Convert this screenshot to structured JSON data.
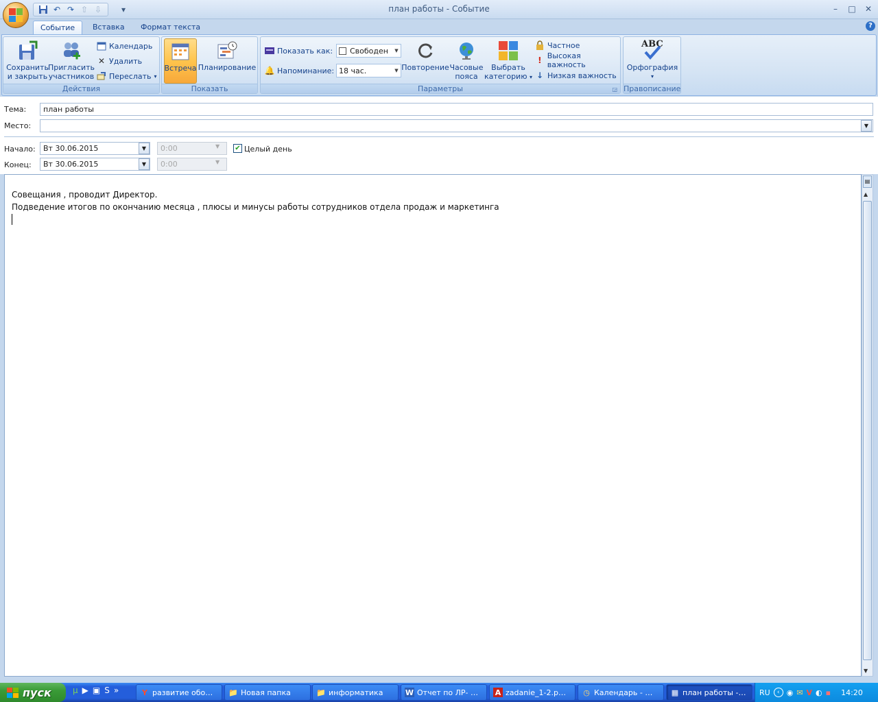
{
  "window": {
    "title": "план работы - Событие",
    "min": "–",
    "max": "□",
    "close": "✕"
  },
  "qat": {
    "save": "💾",
    "undo": "↶",
    "redo": "↷",
    "up": "⇧",
    "down": "⇩",
    "more": "▾"
  },
  "tabs": [
    "Событие",
    "Вставка",
    "Формат текста"
  ],
  "help": "?",
  "ribbon": {
    "actions": {
      "label": "Действия",
      "save": "Сохранить\nи закрыть",
      "invite": "Пригласить\nучастников",
      "calendar": "Календарь",
      "delete": "Удалить",
      "forward": "Переслать",
      "forward_arrow": "▾"
    },
    "show": {
      "label": "Показать",
      "meeting": "Встреча",
      "planning": "Планирование"
    },
    "params": {
      "label": "Параметры",
      "show_as_label": "Показать как:",
      "show_as_value": "Свободен",
      "reminder_label": "Напоминание:",
      "reminder_value": "18 час.",
      "recurrence": "Повторение",
      "timezones": "Часовые\nпояса",
      "category": "Выбрать\nкатегорию",
      "category_arrow": "▾",
      "private": "Частное",
      "high": "Высокая важность",
      "low": "Низкая важность"
    },
    "spelling": {
      "label": "Правописание",
      "spell": "Орфография",
      "abc": "ABC",
      "arrow": "▾"
    }
  },
  "form": {
    "subject_label": "Тема:",
    "subject_value": "план работы",
    "location_label": "Место:",
    "location_value": "",
    "start_label": "Начало:",
    "start_date": "Вт 30.06.2015",
    "start_time": "0:00",
    "end_label": "Конец:",
    "end_date": "Вт 30.06.2015",
    "end_time": "0:00",
    "allday_label": "Целый день",
    "allday_checked": true
  },
  "body": {
    "line1": "Совещания , проводит Директор.",
    "line2": "Подведение итогов по окончанию месяца , плюсы и минусы работы сотрудников отдела продаж и маркетинга"
  },
  "taskbar": {
    "start": "пуск",
    "items": [
      {
        "label": "развитие обо…",
        "icon": "Y"
      },
      {
        "label": "Новая папка",
        "icon": "📁"
      },
      {
        "label": "информатика",
        "icon": "📁"
      },
      {
        "label": "Отчет по ЛР- …",
        "icon": "W"
      },
      {
        "label": "zadanie_1-2.p…",
        "icon": "A"
      },
      {
        "label": "Календарь - …",
        "icon": "◷"
      },
      {
        "label": "план работы -…",
        "icon": "▦"
      }
    ],
    "lang": "RU",
    "clock": "14:20"
  },
  "colors": {
    "accent": "#15428b",
    "ribbon": "#d5e4f4",
    "taskbar": "#245edb",
    "start": "#3a9b37"
  }
}
